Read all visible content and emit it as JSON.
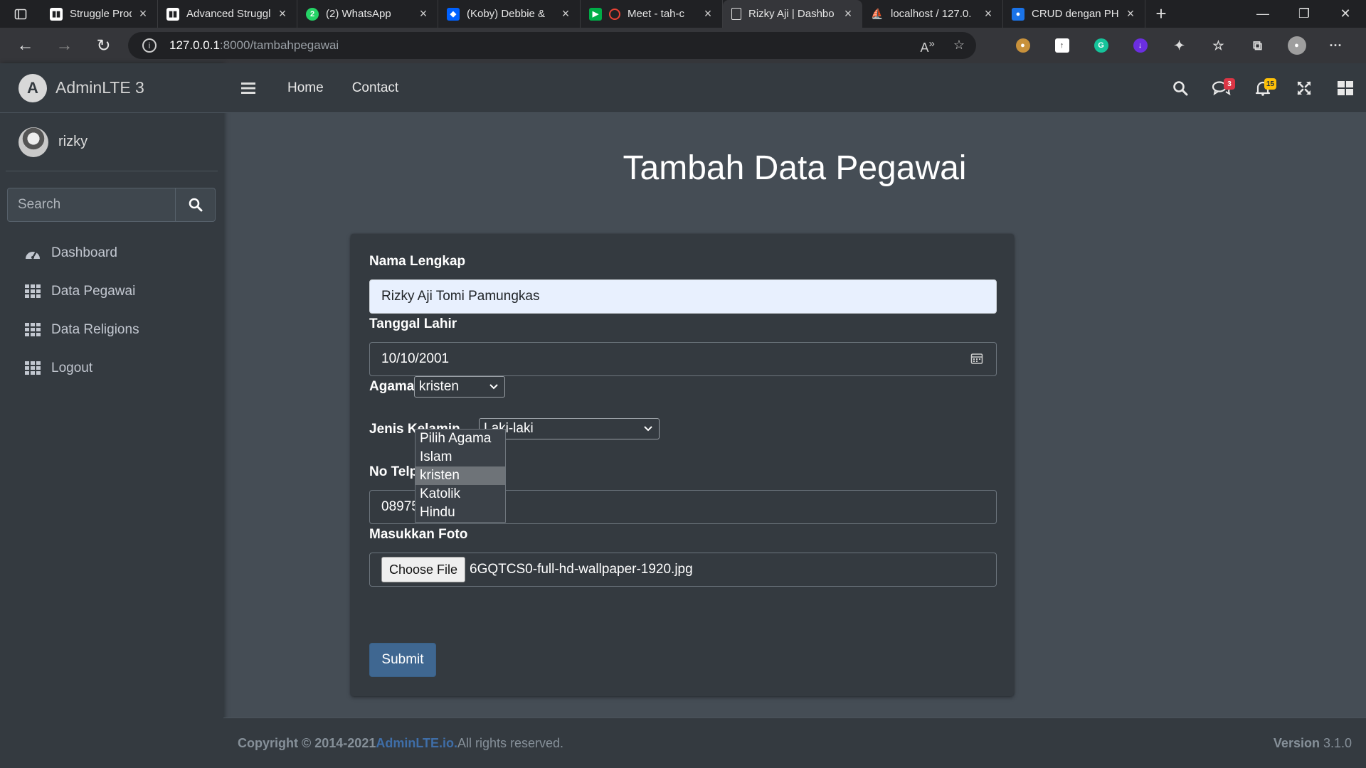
{
  "browser": {
    "tabs": [
      {
        "title": "Struggle Prod. | Tr",
        "icon": "trello-icon",
        "color": "#ffffff"
      },
      {
        "title": "Advanced Struggl",
        "icon": "trello-icon",
        "color": "#ffffff"
      },
      {
        "title": "(2) WhatsApp",
        "icon": "whatsapp-icon",
        "color": "#25d366"
      },
      {
        "title": "(Koby) Debbie &",
        "icon": "dropbox-icon",
        "color": "#0061ff"
      },
      {
        "title": "Meet - tah-c",
        "icon": "recording-icon",
        "color": "#ea4335"
      },
      {
        "title": "Rizky Aji | Dashbo",
        "icon": "page-icon",
        "color": "#ffffff",
        "active": true
      },
      {
        "title": "localhost / 127.0.",
        "icon": "phpmyadmin-icon",
        "color": "#f39c12"
      },
      {
        "title": "CRUD dengan PH",
        "icon": "site-icon",
        "color": "#1a73e8"
      }
    ],
    "url_host": "127.0.0.1",
    "url_path": ":8000/tambahpegawai"
  },
  "sidebar": {
    "brand": "AdminLTE 3",
    "brand_logo": "A",
    "user": "rizky",
    "search_placeholder": "Search",
    "items": [
      {
        "label": "Dashboard",
        "icon": "dashboard-icon"
      },
      {
        "label": "Data Pegawai",
        "icon": "grid-icon"
      },
      {
        "label": "Data Religions",
        "icon": "grid-icon"
      },
      {
        "label": "Logout",
        "icon": "grid-icon"
      }
    ]
  },
  "topnav": {
    "links": [
      "Home",
      "Contact"
    ],
    "messages_badge": "3",
    "notifications_badge": "15"
  },
  "main": {
    "title": "Tambah Data Pegawai",
    "form": {
      "nama_label": "Nama Lengkap",
      "nama_value": "Rizky Aji Tomi Pamungkas",
      "tanggal_label": "Tanggal Lahir",
      "tanggal_value": "10/10/2001",
      "agama_label": "Agama",
      "agama_value": "kristen",
      "agama_options": [
        "Pilih Agama",
        "Islam",
        "kristen",
        "Katolik",
        "Hindu"
      ],
      "jenis_label": "Jenis Kelamin",
      "jenis_value": "Laki-laki",
      "telp_label": "No Telpon",
      "telp_value": "089756436745",
      "foto_label": "Masukkan Foto",
      "file_button": "Choose File",
      "file_name": "6GQTCS0-full-hd-wallpaper-1920.jpg",
      "submit": "Submit"
    }
  },
  "footer": {
    "copyright": "Copyright © 2014-2021 ",
    "link": "AdminLTE.io.",
    "rights": " All rights reserved.",
    "version_label": "Version",
    "version_value": " 3.1.0"
  },
  "colors": {
    "bg": "#454d55",
    "panel": "#343a40",
    "primary_button": "#3f6791",
    "link": "#3f6ea8"
  }
}
